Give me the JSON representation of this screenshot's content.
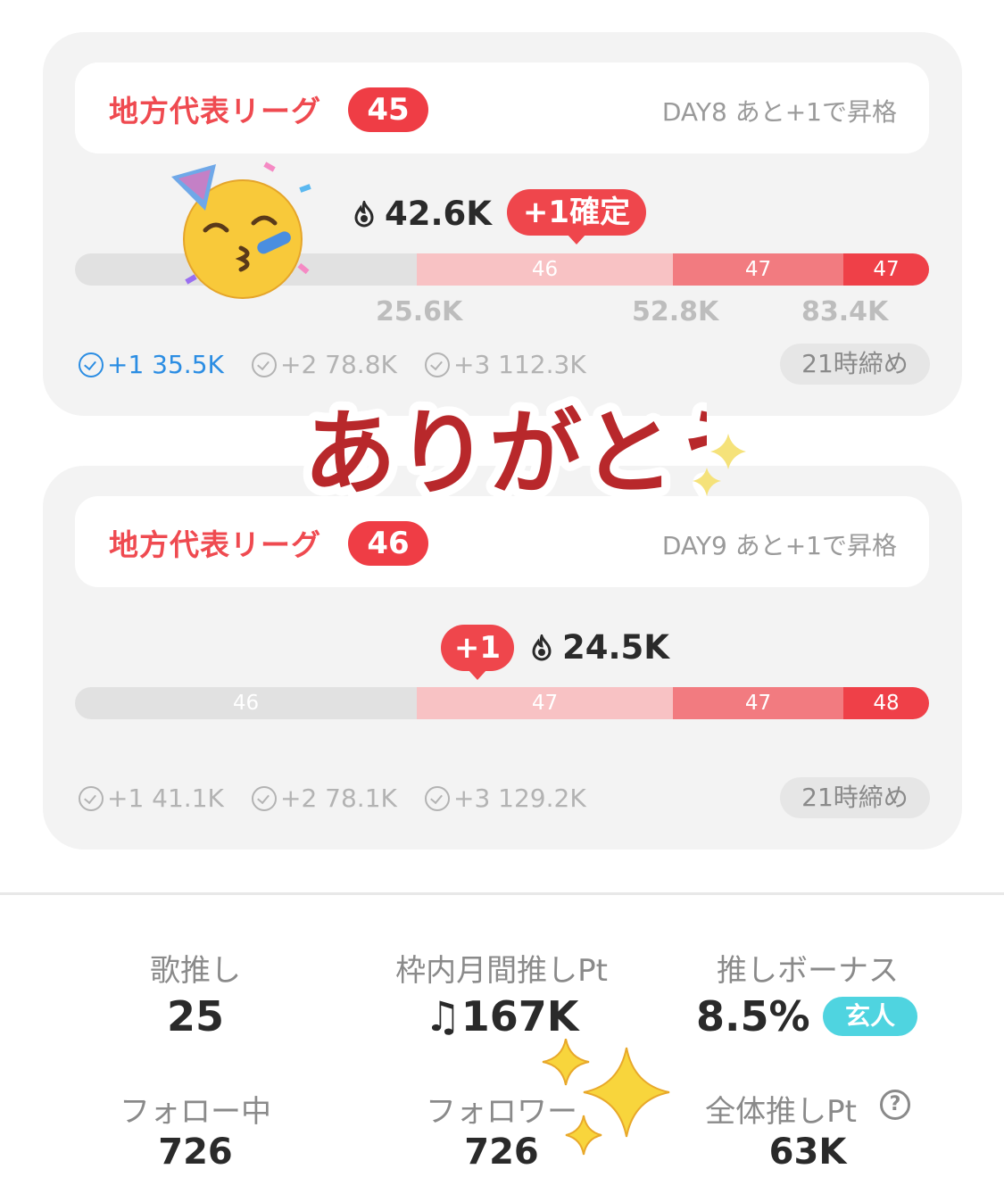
{
  "cards": [
    {
      "league_name": "地方代表リーグ",
      "league_number": "45",
      "day_text": "DAY8 あと+1で昇格",
      "flame_value": "42.6K",
      "bubble_label": "+1確定",
      "segments": [
        "",
        "46",
        "47",
        "47"
      ],
      "thresholds": [
        "25.6K",
        "52.8K",
        "83.4K"
      ],
      "goals": [
        {
          "label": "+1 35.5K",
          "active": true
        },
        {
          "label": "+2 78.8K",
          "active": false
        },
        {
          "label": "+3 112.3K",
          "active": false
        }
      ],
      "deadline": "21時締め"
    },
    {
      "league_name": "地方代表リーグ",
      "league_number": "46",
      "day_text": "DAY9 あと+1で昇格",
      "flame_value": "24.5K",
      "bubble_label": "+1",
      "segments": [
        "46",
        "47",
        "47",
        "48"
      ],
      "goals": [
        {
          "label": "+1 41.1K",
          "active": false
        },
        {
          "label": "+2 78.1K",
          "active": false
        },
        {
          "label": "+3 129.2K",
          "active": false
        }
      ],
      "deadline": "21時締め"
    }
  ],
  "overlay": {
    "thanks_text": "ありがとう",
    "colors": {
      "thanks_fill": "#b8282b",
      "sparkle": "#f5d33a"
    },
    "icons": [
      "party-face-icon",
      "sparkles-icon"
    ]
  },
  "stats": {
    "song_oshi_label": "歌推し",
    "song_oshi_value": "25",
    "monthly_pt_label": "枠内月間推しPt",
    "monthly_pt_value": "♫167K",
    "bonus_label": "推しボーナス",
    "bonus_value": "8.5%",
    "bonus_badge": "玄人",
    "following_label": "フォロー中",
    "following_value": "726",
    "followers_label": "フォロワー",
    "followers_value": "726",
    "total_pt_label": "全体推しPt",
    "total_pt_value": "63K",
    "help_icon": "?"
  },
  "colors": {
    "accent_red": "#ef464c",
    "link_blue": "#2b8de3",
    "badge_cyan": "#4fd4e0"
  }
}
